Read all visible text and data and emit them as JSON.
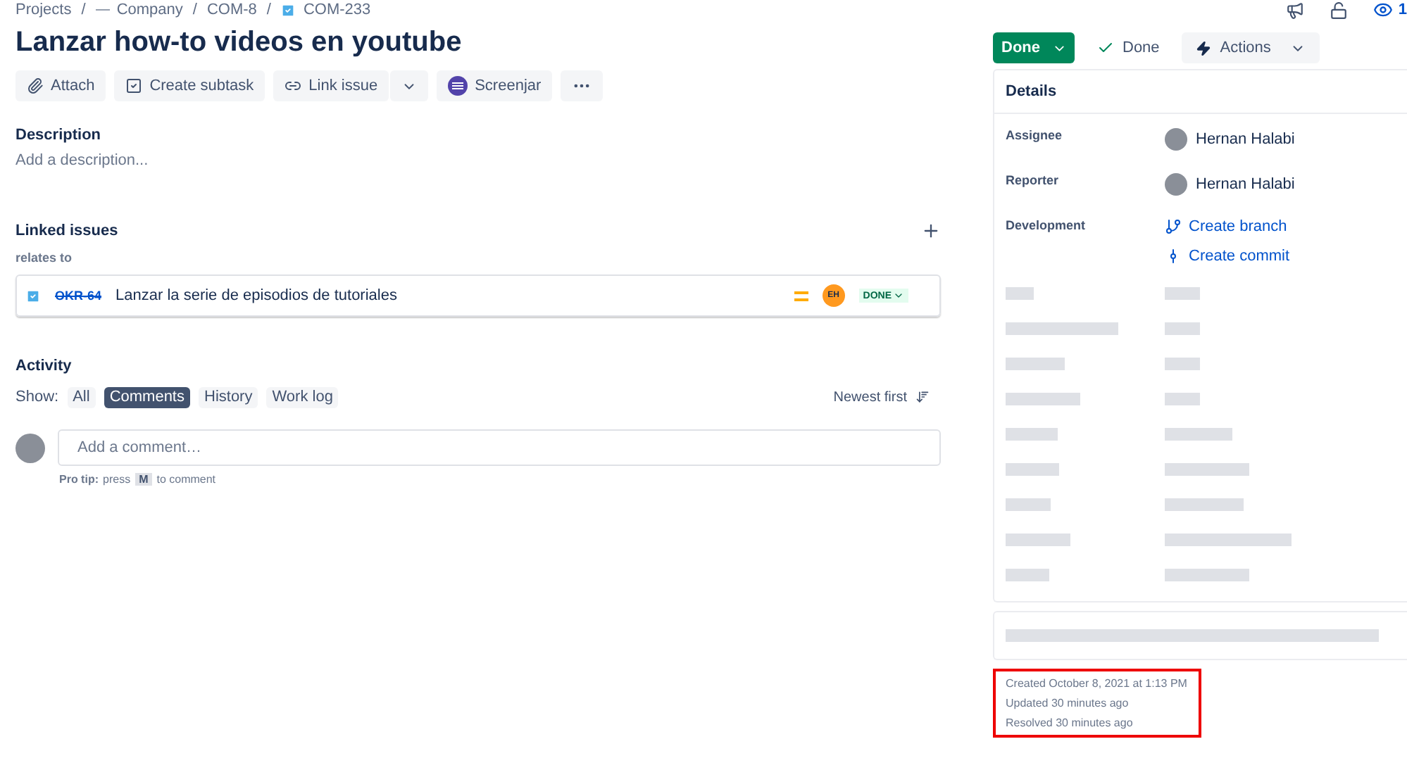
{
  "breadcrumbs": [
    {
      "label": "Projects"
    },
    {
      "separator": "/",
      "label": "Company"
    },
    {
      "separator": "/",
      "label": "COM-8"
    },
    {
      "separator": "/",
      "label": "COM-233"
    }
  ],
  "top_icons": {
    "watchers": "1"
  },
  "issue": {
    "title": "Lanzar how-to videos en youtube"
  },
  "toolbar": [
    {
      "label": "Attach",
      "kind": "attach"
    },
    {
      "label": "Create subtask",
      "kind": "subtask"
    },
    {
      "label": "Link issue",
      "kind": "link"
    },
    {
      "label": "Screenjar",
      "kind": "screenjar"
    },
    {
      "kind": "more"
    }
  ],
  "description": {
    "heading": "Description",
    "placeholder": "Add a description..."
  },
  "linked_issues": {
    "heading": "Linked issues",
    "relation": "relates to",
    "items": [
      {
        "key": "OKR-64",
        "resolved": true,
        "summary": "Lanzar la serie de episodios de tutoriales",
        "assignee_initials": "EH",
        "status": "DONE"
      }
    ]
  },
  "activity": {
    "heading": "Activity",
    "show_label": "Show:",
    "filters": [
      {
        "label": "All",
        "selected": false
      },
      {
        "label": "Comments",
        "selected": true
      },
      {
        "label": "History",
        "selected": false
      },
      {
        "label": "Work log",
        "selected": false
      }
    ],
    "sort": "Newest first",
    "comment_placeholder": "Add a comment…",
    "tip": {
      "lead": "Pro tip:",
      "before": "press",
      "key": "M",
      "after": "to comment"
    }
  },
  "status_bar": {
    "status_button": "Done",
    "resolution": "Done",
    "actions": "Actions"
  },
  "details": {
    "heading": "Details",
    "fields": [
      {
        "label": "Assignee",
        "kind": "person",
        "values": [
          "Hernan Halabi"
        ]
      },
      {
        "label": "Reporter",
        "kind": "person",
        "values": [
          "Hernan Halabi"
        ]
      },
      {
        "label": "Development",
        "kind": "dev",
        "values": [
          "Create branch",
          "Create commit"
        ]
      }
    ]
  },
  "timestamps": {
    "highlighted": true,
    "lines": [
      "Created October 8, 2021 at 1:13 PM",
      "Updated 30 minutes ago",
      "Resolved 30 minutes ago"
    ]
  }
}
